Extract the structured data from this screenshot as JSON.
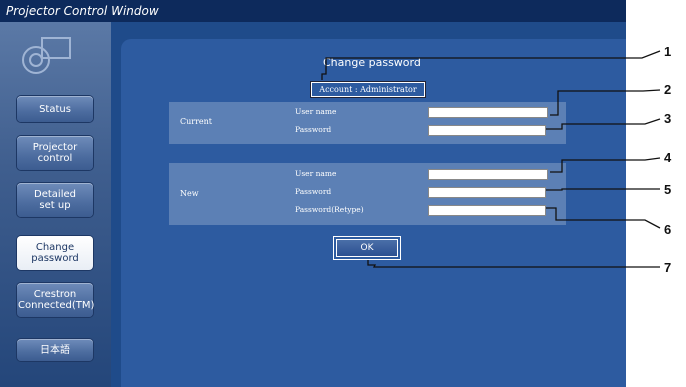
{
  "window": {
    "title": "Projector Control Window"
  },
  "sidebar": {
    "items": [
      {
        "label": "Status"
      },
      {
        "label": "Projector control"
      },
      {
        "label": "Detailed set up"
      },
      {
        "label": "Change password"
      },
      {
        "label": "Crestron Connected(TM)"
      },
      {
        "label": "日本語"
      }
    ],
    "active_index": 3
  },
  "form": {
    "heading": "Change password",
    "account": "Account  :  Administrator",
    "current": {
      "label": "Current",
      "user_name_label": "User name",
      "password_label": "Password",
      "user_name_value": "",
      "password_value": ""
    },
    "new": {
      "label": "New",
      "user_name_label": "User name",
      "password_label": "Password",
      "retype_label": "Password(Retype)",
      "user_name_value": "",
      "password_value": "",
      "retype_value": ""
    },
    "ok_label": "OK"
  },
  "callouts": [
    "1",
    "2",
    "3",
    "4",
    "5",
    "6",
    "7"
  ],
  "colors": {
    "titlebar": "#0d2a5c",
    "main": "#1f4b8a",
    "panel": "#5c80b5",
    "button": "#4c6c9f"
  }
}
